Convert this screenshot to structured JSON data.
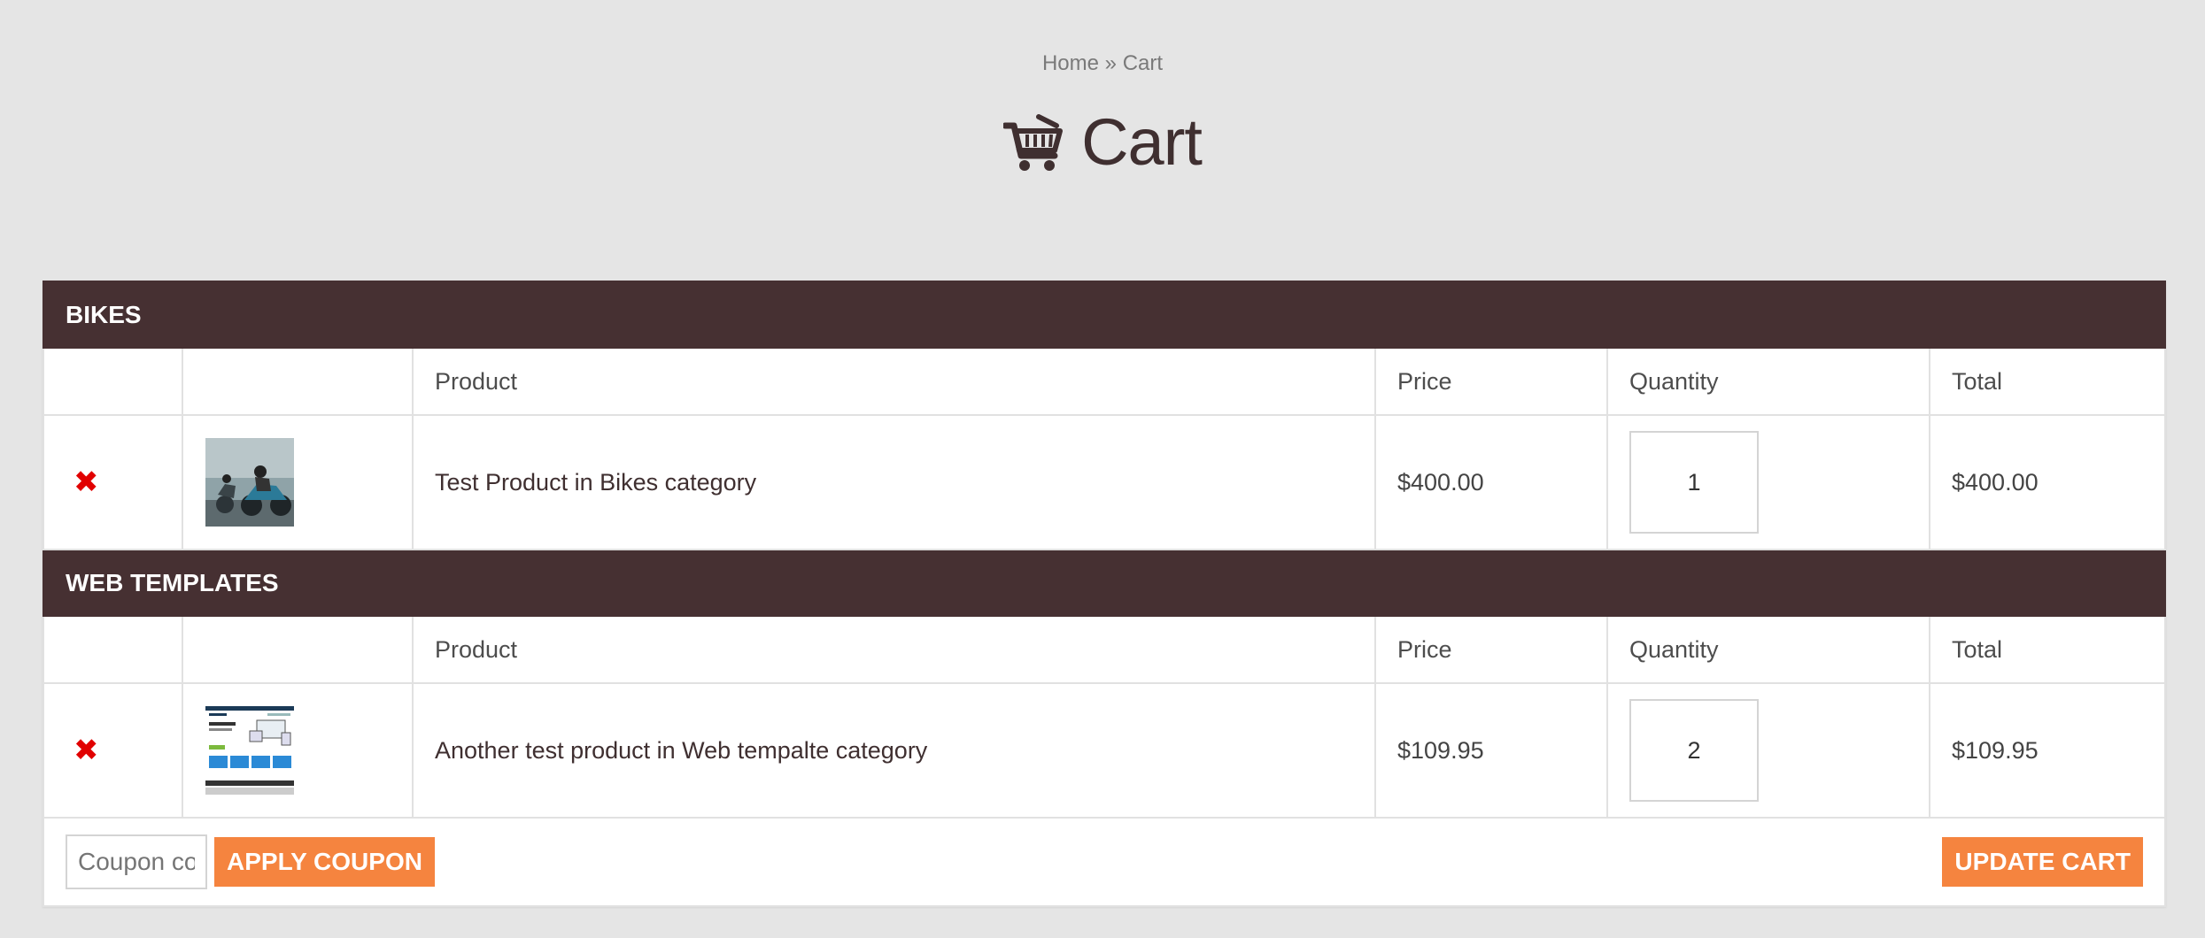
{
  "breadcrumb": {
    "home": "Home",
    "separator": " » ",
    "current": "Cart"
  },
  "page": {
    "title": "Cart",
    "icon": "shopping-cart-icon"
  },
  "table": {
    "headers": {
      "product": "Product",
      "price": "Price",
      "quantity": "Quantity",
      "total": "Total"
    },
    "groups": [
      {
        "category": "BIKES",
        "items": [
          {
            "remove_icon": "✖",
            "name": "Test Product in Bikes category",
            "price": "$400.00",
            "quantity": "1",
            "total": "$400.00",
            "thumbnail": "motorcycle-photo"
          }
        ]
      },
      {
        "category": "WEB TEMPLATES",
        "items": [
          {
            "remove_icon": "✖",
            "name": "Another test product in Web tempalte category",
            "price": "$109.95",
            "quantity": "2",
            "total": "$109.95",
            "thumbnail": "website-template-screenshot"
          }
        ]
      }
    ]
  },
  "actions": {
    "coupon_placeholder": "Coupon code",
    "apply_coupon": "APPLY COUPON",
    "update_cart": "UPDATE CART"
  },
  "colors": {
    "category_bg": "#463032",
    "button": "#f5843f",
    "remove": "#e10000"
  }
}
